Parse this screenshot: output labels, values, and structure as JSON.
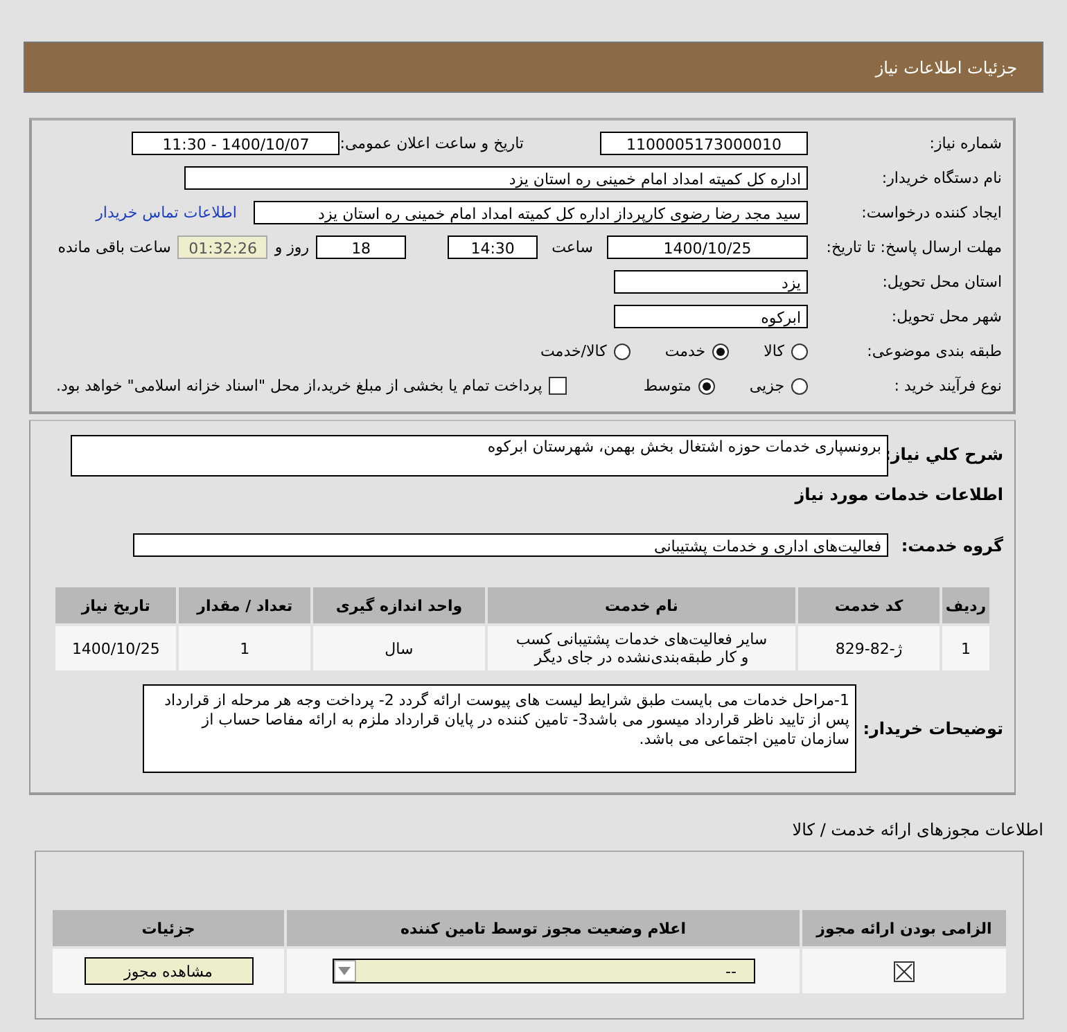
{
  "header": {
    "title": "جزئیات اطلاعات نیاز"
  },
  "info": {
    "need_number": {
      "label": "شماره نیاز:",
      "value": "1100005173000010"
    },
    "announce": {
      "label": "تاریخ و ساعت اعلان عمومی:",
      "value": "1400/10/07 - 11:30"
    },
    "buyer_org": {
      "label": "نام دستگاه خریدار:",
      "value": "اداره کل کمیته امداد امام خمینی  ره  استان یزد"
    },
    "requester": {
      "label": "ایجاد کننده درخواست:",
      "value": "سید مجد رضا رضوی کارپرداز اداره کل کمیته امداد امام خمینی  ره  استان یزد",
      "link": "اطلاعات تماس خریدار"
    },
    "deadline": {
      "label": "مهلت ارسال پاسخ: تا تاریخ:",
      "date": "1400/10/25",
      "time_label": "ساعت",
      "time": "14:30",
      "days": "18",
      "days_label": "روز و",
      "remaining": "01:32:26",
      "remaining_label": "ساعت باقی مانده"
    },
    "province": {
      "label": "استان محل تحویل:",
      "value": "یزد"
    },
    "city": {
      "label": "شهر محل تحویل:",
      "value": "ابرکوه"
    },
    "category": {
      "label": "طبقه بندی موضوعی:",
      "options": [
        {
          "label": "کالا",
          "selected": false
        },
        {
          "label": "خدمت",
          "selected": true
        },
        {
          "label": "کالا/خدمت",
          "selected": false
        }
      ]
    },
    "process": {
      "label": "نوع فرآیند خرید :",
      "options": [
        {
          "label": "جزیی",
          "selected": false
        },
        {
          "label": "متوسط",
          "selected": true
        }
      ],
      "payment": {
        "checked": false,
        "label": "پرداخت تمام یا بخشی از مبلغ خرید،از محل \"اسناد خزانه اسلامی\" خواهد بود."
      }
    }
  },
  "summary": {
    "label": "شرح کلي نياز:",
    "value": "برونسپاری خدمات حوزه اشتغال بخش بهمن، شهرستان ابرکوه"
  },
  "services": {
    "title": "اطلاعات خدمات مورد نیاز",
    "group_label": "گروه خدمت:",
    "group": "فعالیت‌های اداری و خدمات پشتیبانی",
    "columns": [
      "ردیف",
      "کد خدمت",
      "نام خدمت",
      "واحد اندازه گیری",
      "تعداد / مقدار",
      "تاریخ نیاز"
    ],
    "rows": [
      [
        "1",
        "ژ-82-829",
        "سایر فعالیت‌های خدمات پشتیبانی کسب و کار طبقه‌بندی‌نشده در جای دیگر",
        "سال",
        "1",
        "1400/10/25"
      ]
    ]
  },
  "notes": {
    "label": "توضیحات خریدار:",
    "value": "1-مراحل خدمات می بایست طبق شرایط لیست های پیوست ارائه گردد 2- پرداخت وجه هر مرحله از قرارداد پس از تایید ناظر قرارداد میسور می باشد3- تامین کننده در پایان قرارداد ملزم به ارائه مفاصا حساب از سازمان تامین اجتماعی می باشد."
  },
  "permits": {
    "title": "اطلاعات مجوزهای ارائه خدمت / کالا",
    "columns": [
      "الزامی بودن ارائه مجوز",
      "اعلام وضعیت مجوز توسط تامین کننده",
      "جزئیات"
    ],
    "rows": [
      {
        "checked": true,
        "status": "--",
        "button": "مشاهده مجوز"
      }
    ]
  }
}
